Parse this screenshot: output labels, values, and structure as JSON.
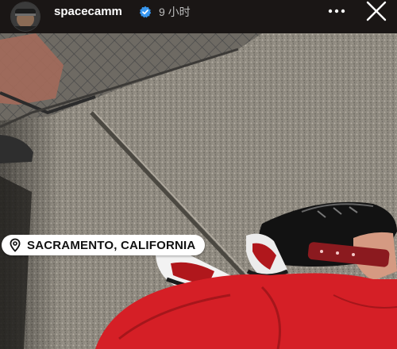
{
  "story": {
    "username": "spacecamm",
    "timestamp": "9 小时",
    "location": "SACRAMENTO, CALIFORNIA"
  },
  "icons": {
    "verified": "verified-badge-icon",
    "more": "more-options-icon",
    "close": "close-icon",
    "location": "location-pin-icon"
  },
  "colors": {
    "header_bg": "#1a1615",
    "sticker_bg": "#ffffff",
    "verified": "#3897f0",
    "pants": "#d51f26"
  }
}
